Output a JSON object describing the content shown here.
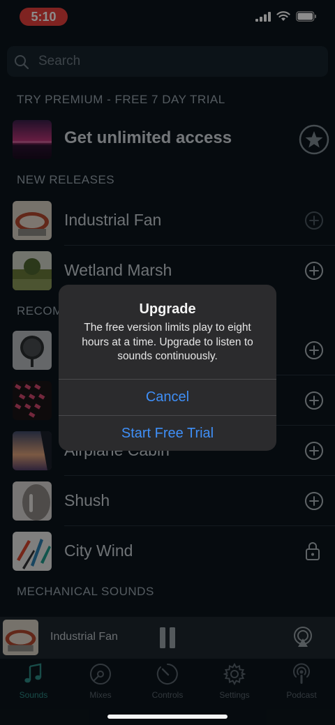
{
  "status": {
    "time": "5:10"
  },
  "search": {
    "placeholder": "Search"
  },
  "sections": {
    "premium": "TRY PREMIUM - FREE 7 DAY TRIAL",
    "new_releases": "NEW RELEASES",
    "recommended_partial": "RECOM",
    "mechanical": "MECHANICAL SOUNDS"
  },
  "premium_row": {
    "title": "Get unlimited access",
    "icon": "star-icon"
  },
  "new_releases": [
    {
      "title": "Industrial Fan",
      "action": "add-icon"
    },
    {
      "title": "Wetland Marsh",
      "action": "add-icon"
    }
  ],
  "recommended": [
    {
      "title": "",
      "action": "add-icon"
    },
    {
      "title": "",
      "action": "add-icon"
    },
    {
      "title": "Airplane Cabin",
      "action": "add-icon"
    },
    {
      "title": "Shush",
      "action": "add-icon"
    },
    {
      "title": "City Wind",
      "action": "lock-icon"
    }
  ],
  "alert": {
    "title": "Upgrade",
    "message": "The free version limits play to eight hours at a time.  Upgrade to listen to sounds continuously.",
    "cancel": "Cancel",
    "confirm": "Start Free Trial"
  },
  "now_playing": {
    "title": "Industrial Fan"
  },
  "tabs": [
    {
      "label": "Sounds",
      "icon": "music-note-icon",
      "active": true
    },
    {
      "label": "Mixes",
      "icon": "disc-icon",
      "active": false
    },
    {
      "label": "Controls",
      "icon": "timer-icon",
      "active": false
    },
    {
      "label": "Settings",
      "icon": "gear-icon",
      "active": false
    },
    {
      "label": "Podcast",
      "icon": "podcast-icon",
      "active": false
    }
  ],
  "colors": {
    "accent": "#2d8b86",
    "alert_button": "#3f8ff7",
    "time_pill": "#e8413c"
  }
}
